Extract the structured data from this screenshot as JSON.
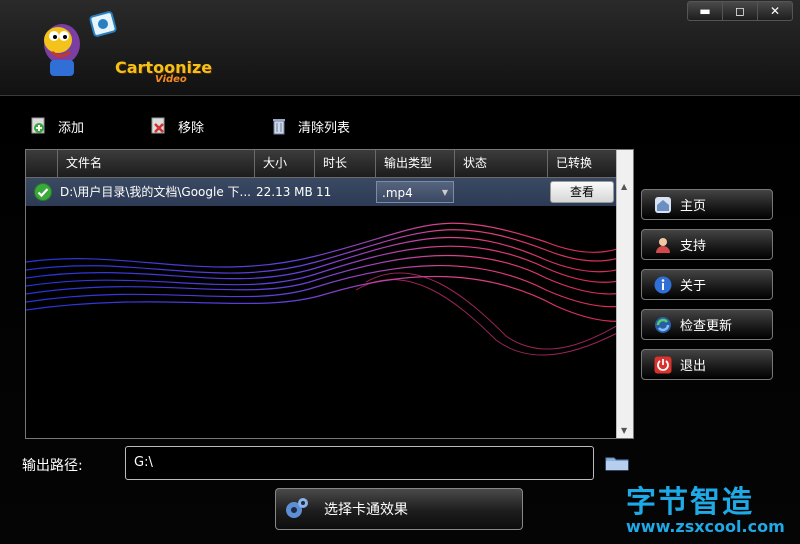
{
  "window": {
    "controls": {
      "minimize": "▬",
      "maximize": "◻",
      "close": "✕"
    }
  },
  "logo": {
    "line1": "Cartoonize",
    "line2": "Video"
  },
  "toolbar": {
    "add_label": "添加",
    "remove_label": "移除",
    "clear_label": "清除列表"
  },
  "table": {
    "headers": [
      "文件名",
      "大小",
      "时长",
      "输出类型",
      "状态",
      "已转换"
    ],
    "rows": [
      {
        "name": "D:\\用户目录\\我的文档\\Google 下...",
        "size": "22.13 MB",
        "duration": "11",
        "type": ".mp4",
        "status": "",
        "action": "查看"
      }
    ]
  },
  "sidebar": {
    "items": [
      {
        "label": "主页",
        "icon": "home-icon"
      },
      {
        "label": "支持",
        "icon": "support-icon"
      },
      {
        "label": "关于",
        "icon": "info-icon"
      },
      {
        "label": "检查更新",
        "icon": "update-icon"
      },
      {
        "label": "退出",
        "icon": "power-icon"
      }
    ]
  },
  "output": {
    "label": "输出路径:",
    "path": "G:\\"
  },
  "effects_button": {
    "label": "选择卡通效果"
  },
  "watermark": {
    "line1": "字节智造",
    "line2": "www.zsxcool.com"
  },
  "colors": {
    "row_highlight": "#334262",
    "accent_blue": "#1ea9e7",
    "check_green": "#3aa83a"
  }
}
